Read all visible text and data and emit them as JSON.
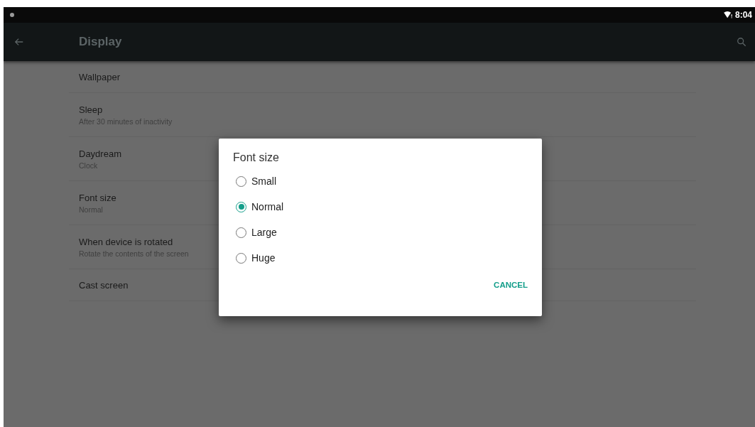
{
  "status_bar": {
    "time": "8:04"
  },
  "toolbar": {
    "title": "Display"
  },
  "settings": [
    {
      "title": "Wallpaper"
    },
    {
      "title": "Sleep",
      "summary": "After 30 minutes of inactivity"
    },
    {
      "title": "Daydream",
      "summary": "Clock"
    },
    {
      "title": "Font size",
      "summary": "Normal"
    },
    {
      "title": "When device is rotated",
      "summary": "Rotate the contents of the screen"
    },
    {
      "title": "Cast screen"
    }
  ],
  "dialog": {
    "title": "Font size",
    "options": [
      {
        "label": "Small",
        "selected": false
      },
      {
        "label": "Normal",
        "selected": true
      },
      {
        "label": "Large",
        "selected": false
      },
      {
        "label": "Huge",
        "selected": false
      }
    ],
    "buttons": [
      "CANCEL"
    ]
  }
}
